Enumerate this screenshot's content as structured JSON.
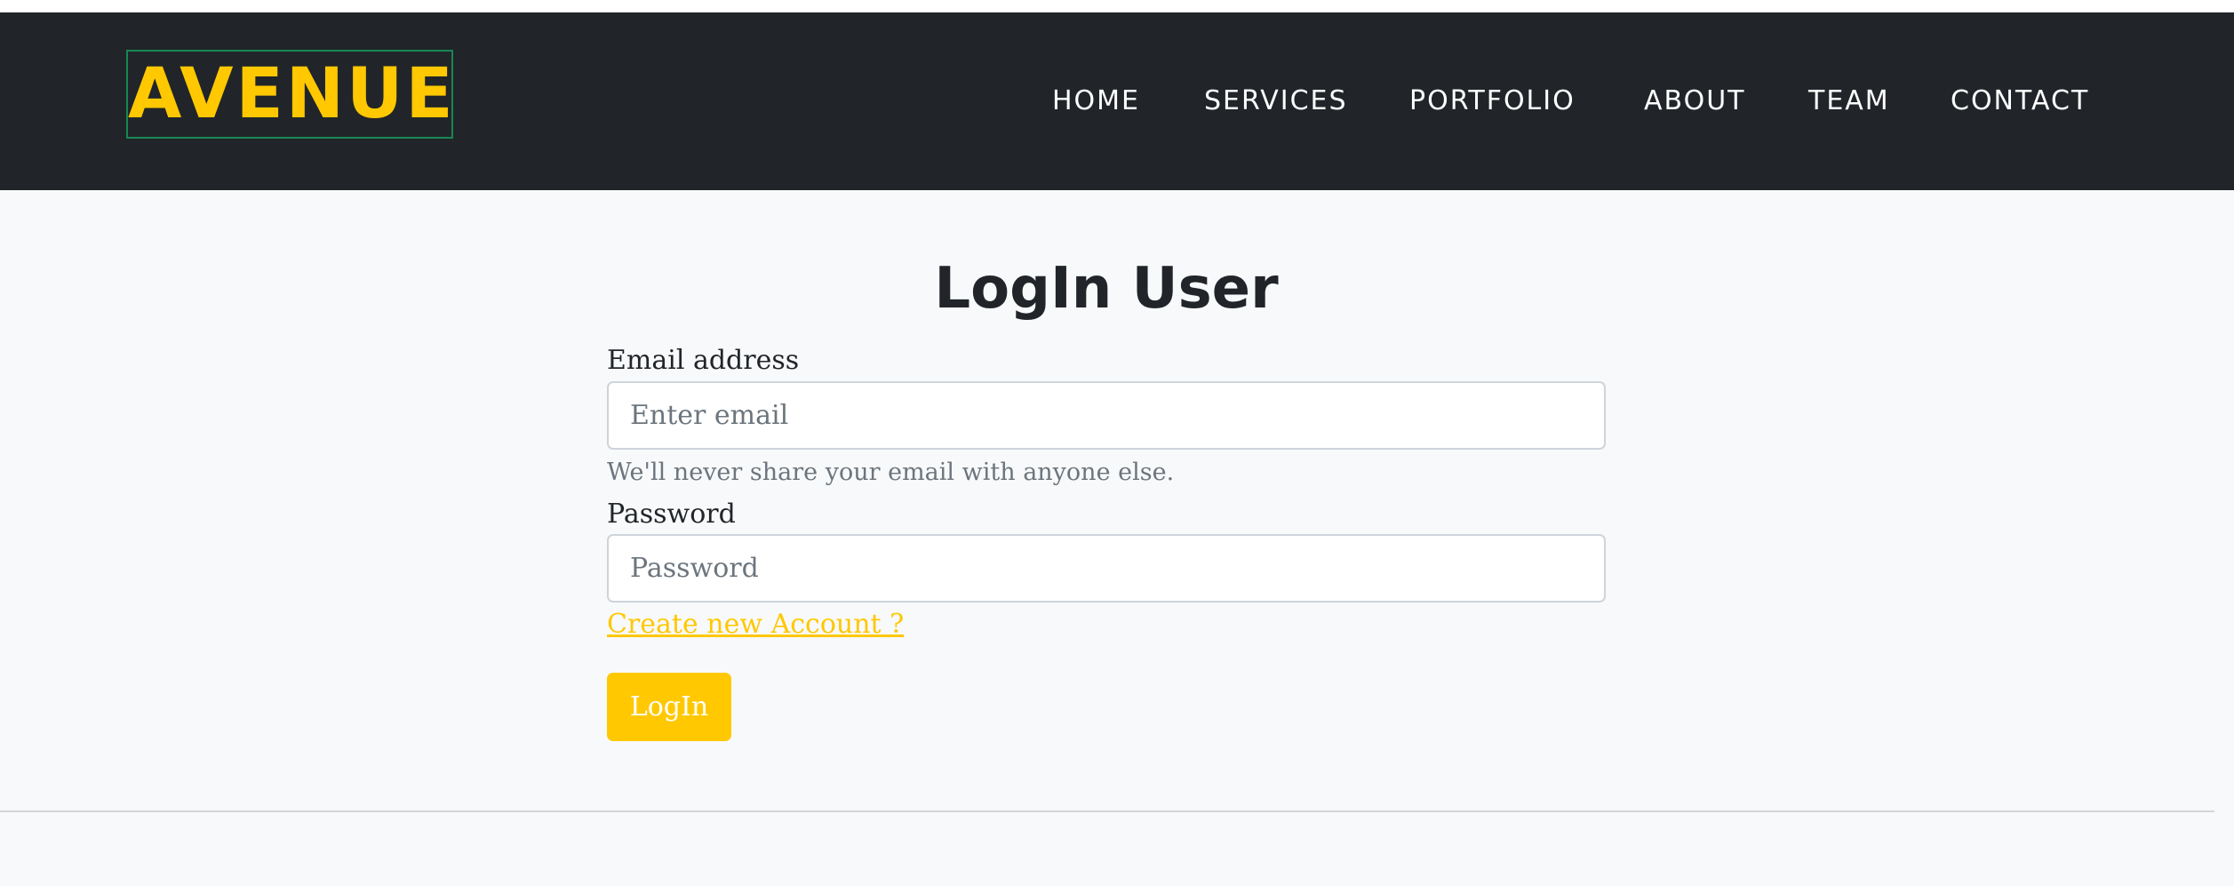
{
  "navbar": {
    "brand": "AVENUE",
    "links": {
      "home": "HOME",
      "services": "SERVICES",
      "portfolio": "PORTFOLIO",
      "about": "ABOUT",
      "team": "TEAM",
      "contact": "CONTACT"
    }
  },
  "form": {
    "title": "LogIn User",
    "email_label": "Email address",
    "email_placeholder": "Enter email",
    "email_value": "",
    "email_help": "We'll never share your email with anyone else.",
    "password_label": "Password",
    "password_placeholder": "Password",
    "password_value": "",
    "create_account_link": "Create new Account ?",
    "login_button": "LogIn"
  },
  "colors": {
    "navbar_bg": "#212529",
    "brand_accent": "#ffc800",
    "page_bg": "#f8f9fa",
    "muted_text": "#6c757d"
  }
}
